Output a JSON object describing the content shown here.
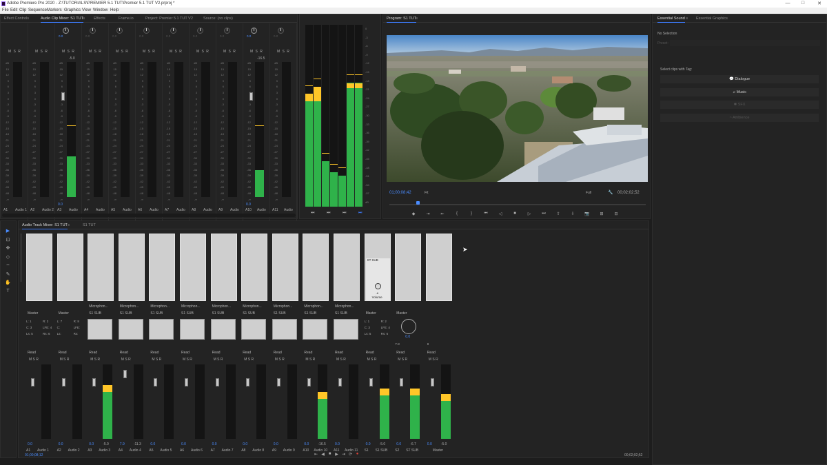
{
  "window": {
    "title": "Adobe Premiere Pro 2020 - Z:\\TUTORIALS\\PREMIER 5.1 TUT\\Premier 5.1 TUT V2.prproj *",
    "buttons": [
      "—",
      "□",
      "✕"
    ]
  },
  "menu": [
    "File",
    "Edit",
    "Clip",
    "Sequence",
    "Markers",
    "Graphics",
    "View",
    "Window",
    "Help"
  ],
  "top_left_panel": {
    "tabs": [
      "Effect Controls",
      "Audio Clip Mixer: S1 TUT",
      "Effects",
      "Frame.io",
      "Project: Premier 5.1 TUT V2",
      "Source: (no clips)"
    ],
    "menu_icon": "≡",
    "msr": "M S R",
    "db_scale": [
      "dB",
      "15",
      "12",
      "9",
      "6",
      "3",
      "0",
      "-3",
      "-6",
      "-9",
      "-12",
      "-15",
      "-18",
      "-21",
      "-24",
      "-27",
      "-30",
      "-33",
      "-36",
      "-39",
      "-42",
      "-45",
      "-48",
      "-∞"
    ],
    "strips": [
      {
        "id": "A1",
        "name": "Audio 1",
        "value": "",
        "knob": false,
        "level": 0,
        "peak": "",
        "fader": "",
        "active": false
      },
      {
        "id": "A2",
        "name": "Audio 2",
        "value": "",
        "knob": false,
        "level": 0,
        "peak": "",
        "fader": "",
        "active": false
      },
      {
        "id": "A3",
        "name": "Audio",
        "value": "0.0",
        "knob": true,
        "level": 0.3,
        "peak": "-5.0",
        "fader": "0.0",
        "active": true
      },
      {
        "id": "A4",
        "name": "Audio",
        "value": "0.0",
        "knob": true,
        "level": 0,
        "peak": "",
        "fader": "",
        "active": false
      },
      {
        "id": "A5",
        "name": "Audio",
        "value": "0.0",
        "knob": true,
        "level": 0,
        "peak": "",
        "fader": "",
        "active": false
      },
      {
        "id": "A6",
        "name": "Audio",
        "value": "0.0",
        "knob": true,
        "level": 0,
        "peak": "",
        "fader": "",
        "active": false
      },
      {
        "id": "A7",
        "name": "Audio",
        "value": "0.0",
        "knob": true,
        "level": 0,
        "peak": "",
        "fader": "",
        "active": false
      },
      {
        "id": "A8",
        "name": "Audio",
        "value": "0.0",
        "knob": true,
        "level": 0,
        "peak": "",
        "fader": "",
        "active": false
      },
      {
        "id": "A9",
        "name": "Audio",
        "value": "0.0",
        "knob": true,
        "level": 0,
        "peak": "",
        "fader": "",
        "active": false
      },
      {
        "id": "A10",
        "name": "Audio",
        "value": "0.0",
        "knob": true,
        "level": 0.2,
        "peak": "-16.5",
        "fader": "0.0",
        "active": true
      },
      {
        "id": "A11",
        "name": "Audio",
        "value": "0.0",
        "knob": true,
        "level": 0,
        "peak": "",
        "fader": "",
        "active": false
      }
    ]
  },
  "master_meter": {
    "scale": [
      "0",
      "-3",
      "-6",
      "-9",
      "-12",
      "-15",
      "-18",
      "-21",
      "-24",
      "-27",
      "-30",
      "-33",
      "-36",
      "-39",
      "-42",
      "-45",
      "-48",
      "-51",
      "-54",
      "-57",
      "dB"
    ],
    "channels": [
      {
        "level": 0.62,
        "peak": 0.04
      },
      {
        "level": 0.66,
        "peak": 0.08
      },
      {
        "level": 0.25,
        "peak": 0
      },
      {
        "level": 0.19,
        "peak": 0
      },
      {
        "level": 0.17,
        "peak": 0
      },
      {
        "level": 0.68,
        "peak": 0.03
      },
      {
        "level": 0.68,
        "peak": 0.03
      }
    ],
    "buttons": [
      "⏭",
      "⏭",
      "⏭",
      "⏭"
    ]
  },
  "program_monitor": {
    "title": "Program: S1 TUT",
    "menu_icon": "≡",
    "timecode": "01;00;08;42",
    "duration": "00;02;02;52",
    "zoom": "Fit",
    "resolution": "Full",
    "playhead": 0.11,
    "controls": [
      "◆",
      "⇥",
      "⇤",
      "{",
      "}",
      "⏮",
      "◁",
      "■",
      "▷",
      "⏭",
      "⇧",
      "⇩",
      "📷",
      "⊞",
      "⊟"
    ]
  },
  "essential_sound": {
    "tabs": [
      "Essential Sound",
      "Essential Graphics"
    ],
    "no_selection": "No Selection",
    "preset_label": "Preset:",
    "prompt": "Select clips with Tag:",
    "buttons": [
      {
        "label": "Dialogue",
        "icon": "💬",
        "enabled": true
      },
      {
        "label": "Music",
        "icon": "♫",
        "enabled": true
      },
      {
        "label": "SFX",
        "icon": "✱",
        "enabled": false
      },
      {
        "label": "Ambience",
        "icon": "~",
        "enabled": false
      }
    ]
  },
  "track_mixer": {
    "tabs": [
      "Audio Track Mixer: S1 TUT",
      "S1 TUT"
    ],
    "menu_icon": "≡",
    "timecode_left": "01;00;08;12",
    "timecode_right": "00;02;02;52",
    "strips": [
      {
        "id": "A1",
        "name": "Audio 1",
        "input": "",
        "output": "Master",
        "mode": "Read",
        "level": 0,
        "value": "0.0",
        "peak": ""
      },
      {
        "id": "A2",
        "name": "Audio 2",
        "input": "",
        "output": "Master",
        "mode": "Read",
        "level": 0,
        "value": "0.0",
        "peak": ""
      },
      {
        "id": "A3",
        "name": "Audio 3",
        "input": "Microphon...",
        "output": "S1 SUB",
        "mode": "Read",
        "level": 0.72,
        "value": "0.0",
        "peak": "-5.0"
      },
      {
        "id": "A4",
        "name": "Audio 4",
        "input": "Microphon...",
        "output": "S1 SUB",
        "mode": "Read",
        "level": 0,
        "value": "7.9",
        "peak": "-11.3"
      },
      {
        "id": "A5",
        "name": "Audio 5",
        "input": "Microphon...",
        "output": "S1 SUB",
        "mode": "Read",
        "level": 0,
        "value": "0.0",
        "peak": ""
      },
      {
        "id": "A6",
        "name": "Audio 6",
        "input": "Microphon...",
        "output": "S1 SUB",
        "mode": "Read",
        "level": 0,
        "value": "0.0",
        "peak": ""
      },
      {
        "id": "A7",
        "name": "Audio 7",
        "input": "Microphon...",
        "output": "S1 SUB",
        "mode": "Read",
        "level": 0,
        "value": "0.0",
        "peak": ""
      },
      {
        "id": "A8",
        "name": "Audio 8",
        "input": "Microphon...",
        "output": "S1 SUB",
        "mode": "Read",
        "level": 0,
        "value": "0.0",
        "peak": ""
      },
      {
        "id": "A9",
        "name": "Audio 9",
        "input": "Microphon...",
        "output": "S1 SUB",
        "mode": "Read",
        "level": 0,
        "value": "0.0",
        "peak": ""
      },
      {
        "id": "A10",
        "name": "Audio 10",
        "input": "Microphon...",
        "output": "S1 SUB",
        "mode": "Read",
        "level": 0.63,
        "value": "0.0",
        "peak": "-16.5"
      },
      {
        "id": "A11",
        "name": "Audio 11",
        "input": "Microphon...",
        "output": "S1 SUB",
        "mode": "Read",
        "level": 0,
        "value": "0.0",
        "peak": ""
      },
      {
        "id": "S1",
        "name": "S1 SUB",
        "input": "",
        "output": "Master",
        "mode": "Read",
        "level": 0.68,
        "value": "0.0",
        "peak": "-5.0"
      },
      {
        "id": "S2",
        "name": "ST SUB",
        "input": "",
        "output": "Master",
        "mode": "Read",
        "level": 0.68,
        "value": "0.0",
        "peak": "-6.7"
      },
      {
        "id": "",
        "name": "Master",
        "input": "",
        "output": "",
        "mode": "Read",
        "level": 0.6,
        "value": "0.0",
        "peak": "-5.0"
      }
    ],
    "channel_labels_a": [
      "L: 1",
      "R: 2",
      "C: 3",
      "LFE: 4",
      "Ls: 5",
      "Rs: 6"
    ],
    "channel_labels_b": [
      "L: 7",
      "R: 8",
      "C:",
      "LFE:",
      "Ls:",
      "Rs:"
    ],
    "channel_labels_s": [
      "L: 1",
      "R: 2",
      "C: 3",
      "LFE: 4",
      "Ls: 5",
      "Rs: 6"
    ],
    "sub_fx_label": "ST SUB",
    "sub_fx_knob_label": "Volume",
    "sub_fx_value": "-6",
    "st_pan_value": "0.0",
    "st_output_labels": [
      "7-8",
      "8"
    ],
    "transport": [
      "⇤",
      "◀",
      "■",
      "▶",
      "⇥",
      "⟳",
      "●"
    ]
  },
  "tools": [
    "▶",
    "⊡",
    "✥",
    "◇",
    "⇔",
    "✎",
    "✋",
    "T"
  ]
}
